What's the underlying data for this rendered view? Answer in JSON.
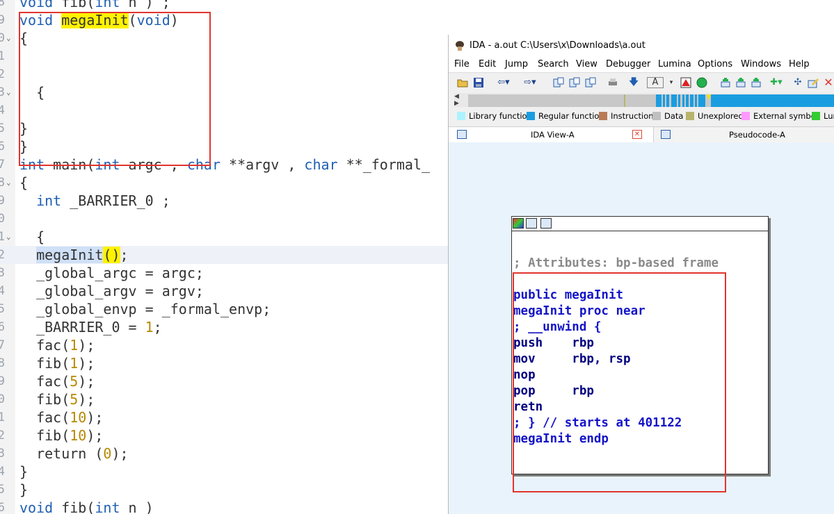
{
  "editor": {
    "lines": [
      {
        "no": "8",
        "fold": false,
        "current": false,
        "parts": [
          {
            "t": "void",
            "c": "kw"
          },
          {
            "t": " fib(",
            "c": ""
          },
          {
            "t": "int",
            "c": "kw"
          },
          {
            "t": " n ) ;",
            "c": ""
          }
        ]
      },
      {
        "no": "9",
        "fold": false,
        "current": false,
        "parts": [
          {
            "t": "void",
            "c": "kw"
          },
          {
            "t": " ",
            "c": ""
          },
          {
            "t": "megaInit",
            "c": "hl"
          },
          {
            "t": "(",
            "c": ""
          },
          {
            "t": "void",
            "c": "kw"
          },
          {
            "t": ")",
            "c": ""
          }
        ]
      },
      {
        "no": "0",
        "fold": true,
        "current": false,
        "parts": [
          {
            "t": "{",
            "c": ""
          }
        ]
      },
      {
        "no": "1",
        "fold": false,
        "current": false,
        "parts": []
      },
      {
        "no": "2",
        "fold": false,
        "current": false,
        "parts": []
      },
      {
        "no": "3",
        "fold": true,
        "current": false,
        "parts": [
          {
            "t": "  {",
            "c": ""
          }
        ]
      },
      {
        "no": "4",
        "fold": false,
        "current": false,
        "parts": []
      },
      {
        "no": "5",
        "fold": false,
        "current": false,
        "parts": [
          {
            "t": "}",
            "c": ""
          }
        ]
      },
      {
        "no": "6",
        "fold": false,
        "current": false,
        "parts": [
          {
            "t": "}",
            "c": ""
          }
        ]
      },
      {
        "no": "7",
        "fold": false,
        "current": false,
        "parts": [
          {
            "t": "int",
            "c": "kw"
          },
          {
            "t": " main(",
            "c": ""
          },
          {
            "t": "int",
            "c": "kw"
          },
          {
            "t": " argc , ",
            "c": ""
          },
          {
            "t": "char",
            "c": "kw"
          },
          {
            "t": " **argv , ",
            "c": ""
          },
          {
            "t": "char",
            "c": "kw"
          },
          {
            "t": " **_formal_",
            "c": ""
          }
        ]
      },
      {
        "no": "8",
        "fold": true,
        "current": false,
        "parts": [
          {
            "t": "{",
            "c": ""
          }
        ]
      },
      {
        "no": "9",
        "fold": false,
        "current": false,
        "parts": [
          {
            "t": "  ",
            "c": ""
          },
          {
            "t": "int",
            "c": "kw"
          },
          {
            "t": " _BARRIER_0 ;",
            "c": ""
          }
        ]
      },
      {
        "no": "0",
        "fold": false,
        "current": false,
        "parts": []
      },
      {
        "no": "1",
        "fold": true,
        "current": false,
        "parts": [
          {
            "t": "  {",
            "c": ""
          }
        ]
      },
      {
        "no": "2",
        "fold": false,
        "current": true,
        "parts": [
          {
            "t": "  ",
            "c": ""
          },
          {
            "t": "megaInit",
            "c": "sel"
          },
          {
            "t": "()",
            "c": "hl"
          },
          {
            "t": ";",
            "c": ""
          }
        ]
      },
      {
        "no": "3",
        "fold": false,
        "current": false,
        "parts": [
          {
            "t": "  _global_argc = argc;",
            "c": ""
          }
        ]
      },
      {
        "no": "4",
        "fold": false,
        "current": false,
        "parts": [
          {
            "t": "  _global_argv = argv;",
            "c": ""
          }
        ]
      },
      {
        "no": "5",
        "fold": false,
        "current": false,
        "parts": [
          {
            "t": "  _global_envp = _formal_envp;",
            "c": ""
          }
        ]
      },
      {
        "no": "6",
        "fold": false,
        "current": false,
        "parts": [
          {
            "t": "  _BARRIER_0 = ",
            "c": ""
          },
          {
            "t": "1",
            "c": "num"
          },
          {
            "t": ";",
            "c": ""
          }
        ]
      },
      {
        "no": "7",
        "fold": false,
        "current": false,
        "parts": [
          {
            "t": "  fac(",
            "c": ""
          },
          {
            "t": "1",
            "c": "num"
          },
          {
            "t": ");",
            "c": ""
          }
        ]
      },
      {
        "no": "8",
        "fold": false,
        "current": false,
        "parts": [
          {
            "t": "  fib(",
            "c": ""
          },
          {
            "t": "1",
            "c": "num"
          },
          {
            "t": ");",
            "c": ""
          }
        ]
      },
      {
        "no": "9",
        "fold": false,
        "current": false,
        "parts": [
          {
            "t": "  fac(",
            "c": ""
          },
          {
            "t": "5",
            "c": "num"
          },
          {
            "t": ");",
            "c": ""
          }
        ]
      },
      {
        "no": "0",
        "fold": false,
        "current": false,
        "parts": [
          {
            "t": "  fib(",
            "c": ""
          },
          {
            "t": "5",
            "c": "num"
          },
          {
            "t": ");",
            "c": ""
          }
        ]
      },
      {
        "no": "1",
        "fold": false,
        "current": false,
        "parts": [
          {
            "t": "  fac(",
            "c": ""
          },
          {
            "t": "10",
            "c": "num"
          },
          {
            "t": ");",
            "c": ""
          }
        ]
      },
      {
        "no": "2",
        "fold": false,
        "current": false,
        "parts": [
          {
            "t": "  fib(",
            "c": ""
          },
          {
            "t": "10",
            "c": "num"
          },
          {
            "t": ");",
            "c": ""
          }
        ]
      },
      {
        "no": "3",
        "fold": false,
        "current": false,
        "parts": [
          {
            "t": "  return (",
            "c": ""
          },
          {
            "t": "0",
            "c": "num"
          },
          {
            "t": ");",
            "c": ""
          }
        ]
      },
      {
        "no": "4",
        "fold": false,
        "current": false,
        "parts": [
          {
            "t": "}",
            "c": ""
          }
        ]
      },
      {
        "no": "5",
        "fold": false,
        "current": false,
        "parts": [
          {
            "t": "}",
            "c": ""
          }
        ]
      },
      {
        "no": "6",
        "fold": false,
        "current": false,
        "parts": [
          {
            "t": "void",
            "c": "kw"
          },
          {
            "t": " fib(",
            "c": ""
          },
          {
            "t": "int",
            "c": "kw"
          },
          {
            "t": " n )",
            "c": ""
          }
        ]
      }
    ]
  },
  "ida": {
    "title": "IDA - a.out C:\\Users\\x\\Downloads\\a.out",
    "menu": [
      "File",
      "Edit",
      "Jump",
      "Search",
      "View",
      "Debugger",
      "Lumina",
      "Options",
      "Windows",
      "Help"
    ],
    "legend": [
      {
        "label": "Library function",
        "color": "#aef2ff"
      },
      {
        "label": "Regular function",
        "color": "#1a9de0"
      },
      {
        "label": "Instruction",
        "color": "#b97a57"
      },
      {
        "label": "Data",
        "color": "#c0c0c0"
      },
      {
        "label": "Unexplored",
        "color": "#b8b46e"
      },
      {
        "label": "External symbol",
        "color": "#ff99ff"
      },
      {
        "label": "Lum",
        "color": "#33cc33"
      }
    ],
    "tabs": {
      "ida_view": "IDA View-A",
      "pseudocode": "Pseudocode-A"
    },
    "graph_node": {
      "lines": [
        {
          "text": "; Attributes: bp-based frame",
          "kind": "cmt"
        },
        {
          "text": "",
          "kind": "blue"
        },
        {
          "text": "public megaInit",
          "kind": "blue"
        },
        {
          "text": "megaInit proc near",
          "kind": "blue"
        },
        {
          "text": "; __unwind {",
          "kind": "blue"
        },
        {
          "text": "push    rbp",
          "kind": "ins"
        },
        {
          "text": "mov     rbp, rsp",
          "kind": "ins"
        },
        {
          "text": "nop",
          "kind": "ins"
        },
        {
          "text": "pop     rbp",
          "kind": "ins"
        },
        {
          "text": "retn",
          "kind": "ins"
        },
        {
          "text": "; } // starts at 401122",
          "kind": "blue"
        },
        {
          "text": "megaInit endp",
          "kind": "blue"
        }
      ]
    }
  }
}
